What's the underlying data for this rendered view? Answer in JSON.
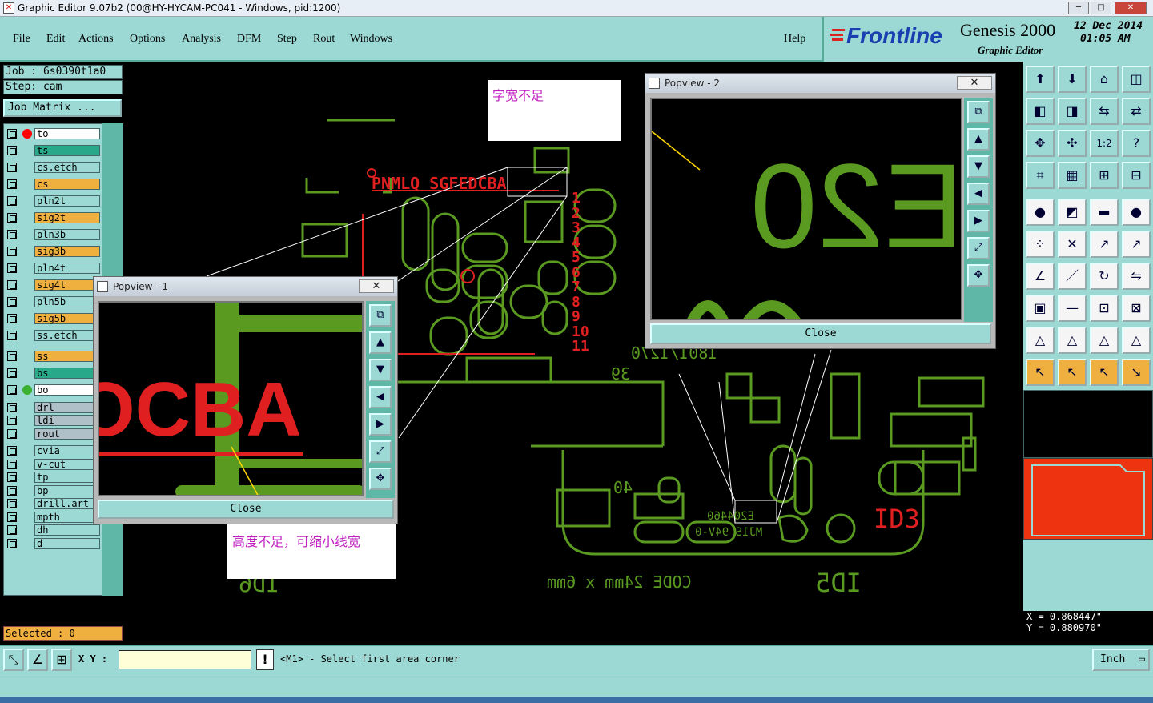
{
  "window": {
    "title": "Graphic Editor 9.07b2 (00@HY-HYCAM-PC041 - Windows, pid:1200)",
    "btn_min": "─",
    "btn_max": "□",
    "btn_close": "✕"
  },
  "menu": {
    "items": [
      "File",
      "Edit",
      "Actions",
      "Options",
      "Analysis",
      "DFM",
      "Step",
      "Rout",
      "Windows"
    ],
    "help": "Help"
  },
  "brand": {
    "logo": "Frontline",
    "product": "Genesis 2000",
    "subtitle": "Graphic Editor",
    "date": "12 Dec 2014",
    "time": "01:05 AM"
  },
  "job": {
    "job_line": "Job : 6s0390t1a0",
    "step_line": "Step: cam",
    "matrix_button": "Job Matrix ..."
  },
  "layers": [
    {
      "name": "to",
      "color": "#ffffff",
      "marker": "#ff0000"
    },
    {
      "name": "ts",
      "color": "#2aa88a",
      "marker": ""
    },
    {
      "name": "cs.etch",
      "color": "#9cd9d4",
      "marker": ""
    },
    {
      "name": "cs",
      "color": "#f0b040",
      "marker": ""
    },
    {
      "name": "pln2t",
      "color": "#9cd9d4",
      "marker": ""
    },
    {
      "name": "sig2t",
      "color": "#f0b040",
      "marker": ""
    },
    {
      "name": "pln3b",
      "color": "#9cd9d4",
      "marker": ""
    },
    {
      "name": "sig3b",
      "color": "#f0b040",
      "marker": ""
    },
    {
      "name": "pln4t",
      "color": "#9cd9d4",
      "marker": ""
    },
    {
      "name": "sig4t",
      "color": "#f0b040",
      "marker": ""
    },
    {
      "name": "pln5b",
      "color": "#9cd9d4",
      "marker": ""
    },
    {
      "name": "sig5b",
      "color": "#f0b040",
      "marker": ""
    },
    {
      "name": "ss.etch",
      "color": "#9cd9d4",
      "marker": ""
    },
    {
      "name": "ss",
      "color": "#f0b040",
      "marker": ""
    },
    {
      "name": "bs",
      "color": "#2aa88a",
      "marker": ""
    },
    {
      "name": "bo",
      "color": "#ffffff",
      "marker": "#3cb030"
    },
    {
      "name": "drl",
      "color": "#b0c0c8",
      "marker": ""
    },
    {
      "name": "ldi",
      "color": "#b0c0c8",
      "marker": ""
    },
    {
      "name": "rout",
      "color": "#b0c0c8",
      "marker": ""
    },
    {
      "name": "cvia",
      "color": "#9cd9d4",
      "marker": ""
    },
    {
      "name": "v-cut",
      "color": "#9cd9d4",
      "marker": ""
    },
    {
      "name": "tp",
      "color": "#9cd9d4",
      "marker": ""
    },
    {
      "name": "bp",
      "color": "#9cd9d4",
      "marker": ""
    },
    {
      "name": "drill.art",
      "color": "#9cd9d4",
      "marker": ""
    },
    {
      "name": "mpth",
      "color": "#9cd9d4",
      "marker": ""
    },
    {
      "name": "dh",
      "color": "#9cd9d4",
      "marker": ""
    },
    {
      "name": "d",
      "color": "#9cd9d4",
      "marker": ""
    }
  ],
  "selected": "Selected : 0",
  "canvas": {
    "pnml": "PNMLQ SGFEDCBA",
    "row_numbers": [
      "1",
      "2",
      "3",
      "4",
      "5",
      "6",
      "7",
      "8",
      "9",
      "10",
      "11"
    ],
    "lbl_39": "39",
    "lbl_40": "40",
    "lbl_id3": "ID3",
    "lbl_id5": "ID5",
    "lbl_id6": "ID6",
    "lbl_code": "CODE 24mm x 6mm",
    "lbl_e204": "E204460",
    "lbl_94v": "MJ1S 94V-0",
    "lbl_rsmall": "1801/1270"
  },
  "notes": {
    "top": "字宽不足",
    "bottom": "高度不足，可缩小线宽"
  },
  "popup1": {
    "title": "Popview - 1",
    "close": "Close",
    "text": "OCBA"
  },
  "popup2": {
    "title": "Popview - 2",
    "close": "Close",
    "text": "E20"
  },
  "status": {
    "xy_label": "X Y :",
    "xy_value": "",
    "warn": "!",
    "message": "<M1> - Select first area corner",
    "units": "Inch"
  },
  "coords": {
    "x": "X = 0.868447\"",
    "y": "Y = 0.880970\""
  }
}
